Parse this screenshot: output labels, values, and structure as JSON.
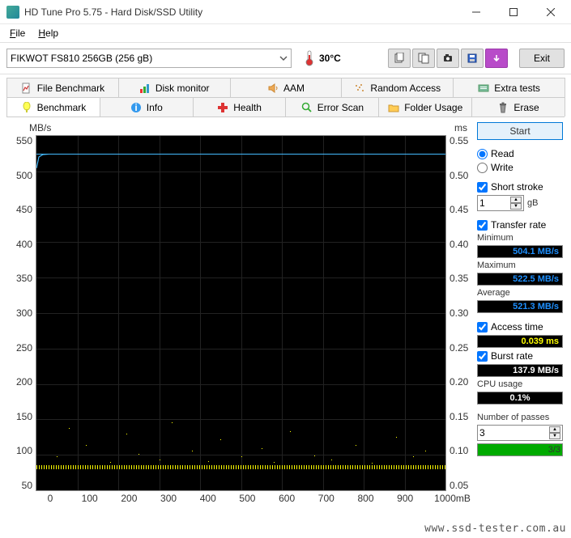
{
  "window": {
    "title": "HD Tune Pro 5.75 - Hard Disk/SSD Utility"
  },
  "menu": {
    "file": "File",
    "help": "Help"
  },
  "toolbar": {
    "drive": "FIKWOT FS810 256GB (256 gB)",
    "temp": "30°C",
    "exit": "Exit"
  },
  "tabs_row1": [
    {
      "label": "File Benchmark"
    },
    {
      "label": "Disk monitor"
    },
    {
      "label": "AAM"
    },
    {
      "label": "Random Access"
    },
    {
      "label": "Extra tests"
    }
  ],
  "tabs_row2": [
    {
      "label": "Benchmark"
    },
    {
      "label": "Info"
    },
    {
      "label": "Health"
    },
    {
      "label": "Error Scan"
    },
    {
      "label": "Folder Usage"
    },
    {
      "label": "Erase"
    }
  ],
  "chart": {
    "unit_left": "MB/s",
    "unit_right": "ms"
  },
  "chart_data": {
    "type": "line",
    "title": "",
    "xlabel": "mB",
    "ylabel_left": "MB/s",
    "ylabel_right": "ms",
    "xlim": [
      0,
      1000
    ],
    "ylim_left": [
      0,
      550
    ],
    "ylim_right": [
      0,
      0.55
    ],
    "x_ticks": [
      0,
      100,
      200,
      300,
      400,
      500,
      600,
      700,
      800,
      900,
      1000
    ],
    "y_ticks_left": [
      50,
      100,
      150,
      200,
      250,
      300,
      350,
      400,
      450,
      500,
      550
    ],
    "y_ticks_right": [
      0.05,
      0.1,
      0.15,
      0.2,
      0.25,
      0.3,
      0.35,
      0.4,
      0.45,
      0.5,
      0.55
    ],
    "series": [
      {
        "name": "Transfer rate (MB/s)",
        "color": "#44bbff",
        "approx_constant": 521,
        "min": 504.1,
        "max": 522.5,
        "avg": 521.3
      },
      {
        "name": "Access time (ms)",
        "color": "#ffff00",
        "approx_constant": 0.039,
        "scatter_range": [
          0.03,
          0.13
        ]
      }
    ]
  },
  "side": {
    "start": "Start",
    "read": "Read",
    "write": "Write",
    "short_stroke": "Short stroke",
    "short_stroke_val": "1",
    "short_stroke_unit": "gB",
    "transfer_rate": "Transfer rate",
    "minimum": "Minimum",
    "min_val": "504.1 MB/s",
    "maximum": "Maximum",
    "max_val": "522.5 MB/s",
    "average": "Average",
    "avg_val": "521.3 MB/s",
    "access_time": "Access time",
    "access_val": "0.039 ms",
    "burst_rate": "Burst rate",
    "burst_val": "137.9 MB/s",
    "cpu_usage": "CPU usage",
    "cpu_val": "0.1%",
    "passes": "Number of passes",
    "passes_val": "3",
    "passes_progress": "3/3"
  },
  "watermark": "www.ssd-tester.com.au",
  "x_unit": "mB"
}
